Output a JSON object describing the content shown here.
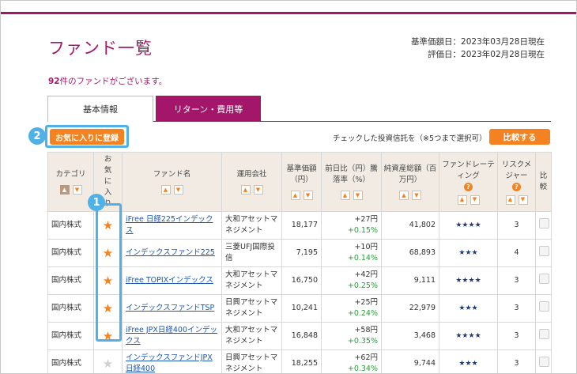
{
  "page": {
    "title": "ファンド一覧",
    "nav_date": "基準価額日：2023年03月28日現在",
    "eval_date": "評価日：2023年02月28日現在",
    "fund_count": "92",
    "fund_count_suffix": "件のファンドがございます。"
  },
  "tabs": [
    {
      "label": "基本情報",
      "active": true
    },
    {
      "label": "リターン・費用等",
      "active": false
    }
  ],
  "toolbar": {
    "favorite_button": "お気に入りに登録",
    "check_note": "チェックした投資信託を（※5つまで選択可）",
    "compare_button": "比較する"
  },
  "markers": {
    "one": "1",
    "two": "2"
  },
  "columns": {
    "category": "カテゴリ",
    "favorite": "お気に入り",
    "fund_name": "ファンド名",
    "company": "運用会社",
    "nav": "基準価額（円）",
    "change": "前日比（円）騰落率（%）",
    "assets": "純資産総額（百万円）",
    "rating": "ファンドレーティング",
    "risk": "リスクメジャー",
    "compare": "比較"
  },
  "icons": {
    "sort_up": "▲",
    "sort_down": "▼",
    "help": "?",
    "star": "★"
  },
  "colors": {
    "brand": "#a4166a",
    "accent": "#f58220",
    "highlight": "#4fb1e6",
    "link": "#1a57b5",
    "positive": "#2aa03a"
  },
  "rows": [
    {
      "category": "国内株式",
      "favorite": true,
      "name": "iFree 日経225インデックス",
      "company": "大和アセットマネジメント",
      "nav": "18,177",
      "change": "+27円",
      "change_pct": "+0.15%",
      "assets": "41,802",
      "rating": "★★★★",
      "risk": "3"
    },
    {
      "category": "国内株式",
      "favorite": true,
      "name": "インデックスファンド225",
      "company": "三菱UFJ国際投信",
      "nav": "7,195",
      "change": "+10円",
      "change_pct": "+0.14%",
      "assets": "68,893",
      "rating": "★★★",
      "risk": "4"
    },
    {
      "category": "国内株式",
      "favorite": true,
      "name": "iFree TOPIXインデックス",
      "company": "大和アセットマネジメント",
      "nav": "16,750",
      "change": "+42円",
      "change_pct": "+0.25%",
      "assets": "9,111",
      "rating": "★★★★",
      "risk": "3"
    },
    {
      "category": "国内株式",
      "favorite": true,
      "name": "インデックスファンドTSP",
      "company": "日興アセットマネジメント",
      "nav": "10,241",
      "change": "+25円",
      "change_pct": "+0.24%",
      "assets": "22,979",
      "rating": "★★★",
      "risk": "3"
    },
    {
      "category": "国内株式",
      "favorite": true,
      "name": "iFree JPX日経400インデックス",
      "company": "大和アセットマネジメント",
      "nav": "16,848",
      "change": "+58円",
      "change_pct": "+0.35%",
      "assets": "3,468",
      "rating": "★★★★",
      "risk": "3"
    },
    {
      "category": "国内株式",
      "favorite": false,
      "name": "インデックスファンドJPX日経400",
      "company": "日興アセットマネジメント",
      "nav": "18,255",
      "change": "+62円",
      "change_pct": "+0.34%",
      "assets": "9,744",
      "rating": "★★★",
      "risk": "3"
    }
  ]
}
